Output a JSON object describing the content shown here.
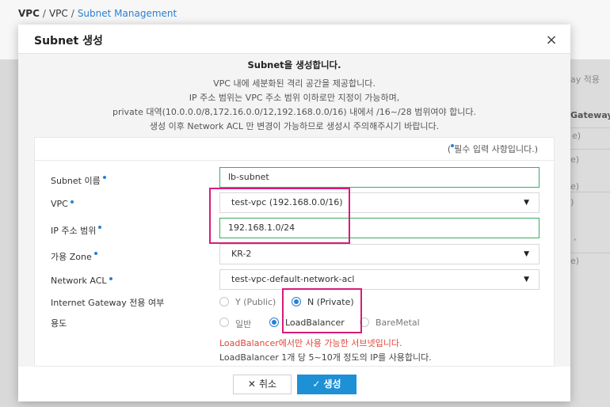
{
  "breadcrumb": {
    "root": "VPC",
    "parent": "VPC",
    "current": "Subnet Management"
  },
  "background": {
    "col_text_1": "ay 적용 ",
    "col_header": "Gateway ",
    "cells": [
      "e)",
      "e)",
      "e)",
      ")",
      ",",
      "e)"
    ]
  },
  "modal": {
    "title": "Subnet 생성",
    "close_icon": "×",
    "intro": {
      "title": "Subnet을 생성합니다.",
      "lines": [
        "VPC 내에 세분화된 격리 공간을 제공합니다.",
        "IP 주소 범위는 VPC 주소 범위 이하로만 지정이 가능하며,",
        "private 대역(10.0.0.0/8,172.16.0.0/12,192.168.0.0/16) 내에서 /16~/28 범위여야 합니다.",
        "생성 이후 Network ACL 만 변경이 가능하므로 생성시 주의해주시기 바랍니다."
      ]
    },
    "required_note": {
      "open": "(",
      "text": "필수 입력 사항입니다.)"
    },
    "form": {
      "subnet_name": {
        "label": "Subnet 이름",
        "value": "lb-subnet"
      },
      "vpc": {
        "label": "VPC",
        "value": "test-vpc (192.168.0.0/16)"
      },
      "ip_range": {
        "label": "IP 주소 범위",
        "value": "192.168.1.0/24"
      },
      "zone": {
        "label": "가용 Zone",
        "value": "KR-2"
      },
      "network_acl": {
        "label": "Network ACL",
        "value": "test-vpc-default-network-acl"
      },
      "igw_only": {
        "label": "Internet Gateway 전용 여부",
        "options": [
          {
            "label": "Y (Public)",
            "selected": false
          },
          {
            "label": "N (Private)",
            "selected": true
          }
        ]
      },
      "usage": {
        "label": "용도",
        "options": [
          {
            "label": "일반",
            "selected": false
          },
          {
            "label": "LoadBalancer",
            "selected": true
          },
          {
            "label": "BareMetal",
            "selected": false
          }
        ]
      },
      "hint_red": "LoadBalancer에서만 사용 가능한 서브넷입니다.",
      "hint_gray": "LoadBalancer 1개 당 5~10개 정도의 IP를 사용합니다."
    },
    "footer": {
      "cancel": {
        "icon": "✕",
        "label": "취소"
      },
      "create": {
        "icon": "✓",
        "label": "생성"
      }
    }
  },
  "colors": {
    "accent": "#1e90d6",
    "highlight": "#d81b7a",
    "valid_border": "#3dab63",
    "warning": "#e0463b"
  }
}
